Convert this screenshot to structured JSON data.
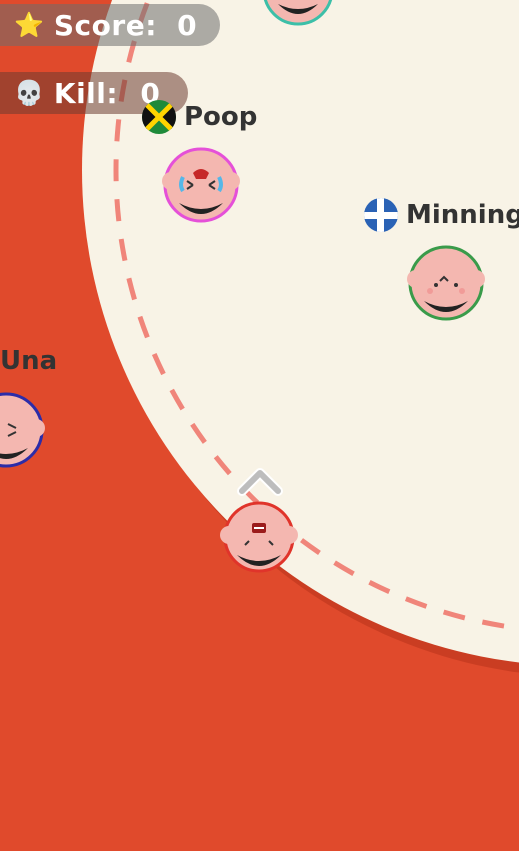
{
  "hud": {
    "score_label": "Score:",
    "score_value": "0",
    "score_icon": "star-icon",
    "kill_label": "Kill:",
    "kill_value": "0",
    "kill_icon": "skull-icon"
  },
  "players": [
    {
      "name": "Poop",
      "flag": "jamaica-flag-icon",
      "ring": "#E550D8"
    },
    {
      "name": "Minning",
      "flag": "finland-flag-icon",
      "ring": "#3A9B4A"
    },
    {
      "name": "Una",
      "flag": "",
      "ring": "#2C2CA8"
    },
    {
      "name": "",
      "flag": "",
      "ring": "#E0342A"
    },
    {
      "name": "",
      "flag": "",
      "ring": "#3CBFA8"
    }
  ],
  "colors": {
    "arena": "#F8F3E6",
    "lava": "#E04A2C",
    "boundary": "#F0857A",
    "skin": "#F4B7B0"
  },
  "direction_indicator": "chevron-up-icon"
}
